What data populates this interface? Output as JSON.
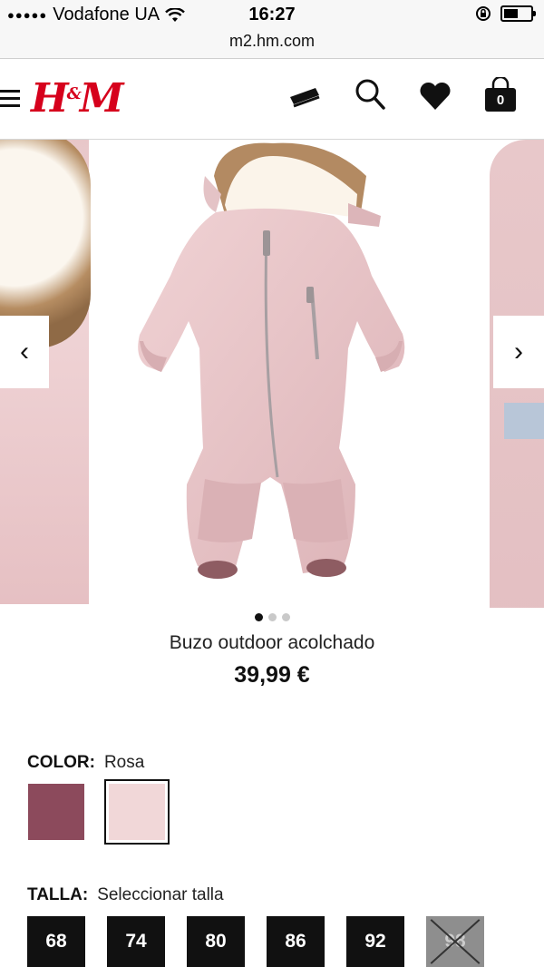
{
  "status_bar": {
    "signal": "●●●●●",
    "carrier": "Vodafone UA",
    "time": "16:27",
    "battery_level": 0.55
  },
  "browser": {
    "url": "m2.hm.com"
  },
  "header": {
    "logo": "H&M",
    "icons": [
      "menu-icon",
      "card-icon",
      "search-icon",
      "heart-icon",
      "bag-icon"
    ],
    "bag_count": "0"
  },
  "carousel": {
    "prev": "‹",
    "next": "›",
    "slides": 3,
    "active_slide": 1
  },
  "product": {
    "name": "Buzo outdoor acolchado",
    "price": "39,99 €"
  },
  "color": {
    "label": "COLOR:",
    "value": "Rosa",
    "swatches": [
      {
        "name": "mauve",
        "color": "#8c4a5c"
      },
      {
        "name": "rosa",
        "color": "#f1d7d8",
        "selected": true
      }
    ]
  },
  "size": {
    "label": "TALLA:",
    "value": "Seleccionar talla",
    "options": [
      {
        "label": "68",
        "available": true
      },
      {
        "label": "74",
        "available": true
      },
      {
        "label": "80",
        "available": true
      },
      {
        "label": "86",
        "available": true
      },
      {
        "label": "92",
        "available": true
      },
      {
        "label": "98",
        "available": false
      }
    ]
  },
  "colors": {
    "brand_red": "#d6001c",
    "dark": "#111111"
  }
}
